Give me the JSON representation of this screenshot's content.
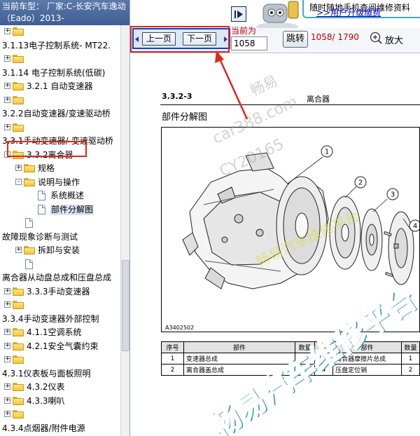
{
  "header": {
    "car_line": "当前车型： 厂家:C-长安汽车逸动（Eado）2013-"
  },
  "tree": {
    "rows": [
      {
        "indent": 0,
        "expander": "+",
        "icon": "folder",
        "label": ""
      },
      {
        "indent": 0,
        "expander": "",
        "icon": "",
        "label": "3.1.13电子控制系统- MT22."
      },
      {
        "indent": 0,
        "expander": "+",
        "icon": "folder",
        "label": ""
      },
      {
        "indent": 0,
        "expander": "",
        "icon": "",
        "label": "3.1.14 电子控制系统(低碳)"
      },
      {
        "indent": 0,
        "expander": "+",
        "icon": "folder",
        "label": "3.2.1 自动变速器"
      },
      {
        "indent": 0,
        "expander": "+",
        "icon": "folder",
        "label": ""
      },
      {
        "indent": 0,
        "expander": "",
        "icon": "",
        "label": "3.2.2自动变速器/变速驱动桥"
      },
      {
        "indent": 0,
        "expander": "+",
        "icon": "folder",
        "label": ""
      },
      {
        "indent": 0,
        "expander": "",
        "icon": "",
        "label": "3.3.1手动变速器/-变速驱动桥"
      },
      {
        "indent": 0,
        "expander": "-",
        "icon": "folder",
        "label": "3.3.2离合器",
        "highlight": true
      },
      {
        "indent": 1,
        "expander": "+",
        "icon": "folder",
        "label": "规格"
      },
      {
        "indent": 1,
        "expander": "-",
        "icon": "folder",
        "label": "说明与操作"
      },
      {
        "indent": 2,
        "expander": "",
        "icon": "page",
        "label": "系统概述"
      },
      {
        "indent": 2,
        "expander": "",
        "icon": "page",
        "label": "部件分解图",
        "selected": true
      },
      {
        "indent": 1,
        "expander": "",
        "icon": "page",
        "label": ""
      },
      {
        "indent": 0,
        "expander": "",
        "icon": "",
        "label": "故障现象诊断与测试"
      },
      {
        "indent": 1,
        "expander": "+",
        "icon": "folder",
        "label": "拆卸与安装"
      },
      {
        "indent": 1,
        "expander": "",
        "icon": "page",
        "label": ""
      },
      {
        "indent": 0,
        "expander": "",
        "icon": "",
        "label": "离合器从动盘总成和压盘总成"
      },
      {
        "indent": 0,
        "expander": "+",
        "icon": "folder",
        "label": "3.3.3手动变速器"
      },
      {
        "indent": 0,
        "expander": "+",
        "icon": "folder",
        "label": ""
      },
      {
        "indent": 0,
        "expander": "",
        "icon": "",
        "label": "3.3.4手动变速器外部控制"
      },
      {
        "indent": 0,
        "expander": "+",
        "icon": "folder",
        "label": "4.1.1空调系统"
      },
      {
        "indent": 0,
        "expander": "+",
        "icon": "folder",
        "label": "4.2.1安全气囊约束"
      },
      {
        "indent": 0,
        "expander": "+",
        "icon": "folder",
        "label": ""
      },
      {
        "indent": 0,
        "expander": "",
        "icon": "",
        "label": "4.3.1仪表板与面板照明"
      },
      {
        "indent": 0,
        "expander": "+",
        "icon": "folder",
        "label": "4.3.2仪表"
      },
      {
        "indent": 0,
        "expander": "+",
        "icon": "folder",
        "label": "4.3.3喇叭"
      },
      {
        "indent": 0,
        "expander": "+",
        "icon": "folder",
        "label": ""
      },
      {
        "indent": 0,
        "expander": "",
        "icon": "",
        "label": "4.3.4点烟器/附件电源"
      },
      {
        "indent": 0,
        "expander": "+",
        "icon": "folder",
        "label": ""
      }
    ]
  },
  "promo": {
    "text": "随时随地手机查阅维修资料",
    "link": ">>用户升级缴费"
  },
  "toolbar": {
    "prev_label": "上一页",
    "next_label": "下一页",
    "current_label": "当前为",
    "page_value": "1058",
    "jump_label": "跳转",
    "page_count": "1058/ 1790",
    "zoom_label": "放大"
  },
  "document": {
    "section_number": "3.3.2-3",
    "section_name": "离合器",
    "title": "部件分解图",
    "figure_code": "A3402502",
    "callouts": [
      "1",
      "2",
      "3",
      "4"
    ],
    "table": {
      "headers": [
        "序号",
        "部件",
        "数量",
        "序号",
        "部件",
        "数量"
      ],
      "rows": [
        [
          "1",
          "变速器总成",
          "1",
          "3",
          "离合器摩擦片总成",
          "1"
        ],
        [
          "2",
          "离合器盖总成",
          "1",
          "4",
          "压盘定位销",
          "2"
        ]
      ]
    }
  },
  "watermarks": {
    "w1": "畅易",
    "w2": "car388.com",
    "w3": "CY20165",
    "w4": "畅易汽车维修平台",
    "w5": "畅易汽车维修平台"
  },
  "colors": {
    "header_bg": "#4a6a9c",
    "highlight_box": "#e0261c",
    "nav_border": "#1b3fbd",
    "arrow": "#e0261c",
    "red_text": "#c00000",
    "watermark_big": "#2fb8d8"
  }
}
